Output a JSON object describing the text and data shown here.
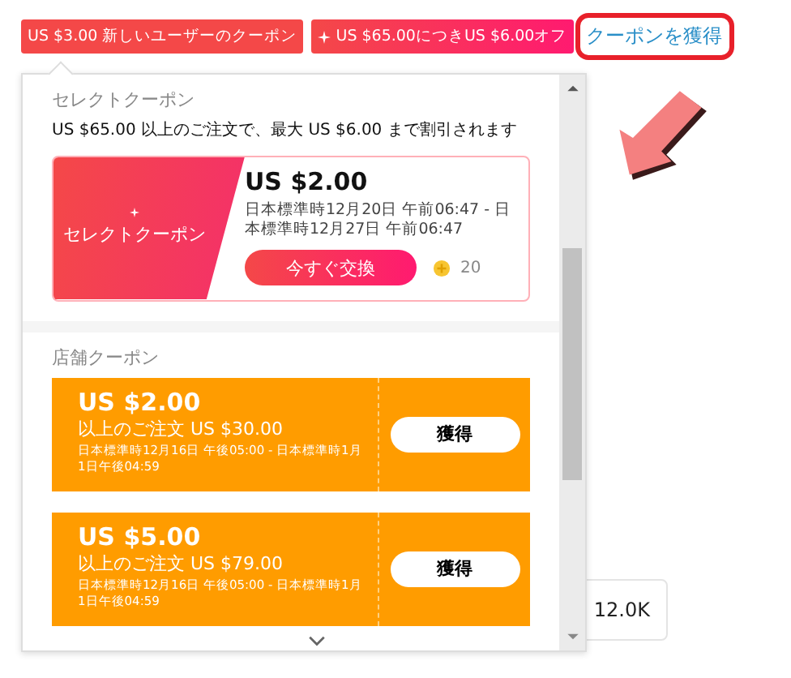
{
  "tags": [
    {
      "text": "US $3.00 新しいユーザーのクーポン",
      "kind": "plain"
    },
    {
      "text": "US $65.00につきUS $6.00オフ",
      "kind": "spark"
    }
  ],
  "get_coupon_link": {
    "text": "クーポンを獲得",
    "highlighted": true
  },
  "popup": {
    "select_section": {
      "title": "セレクトクーポン",
      "description": "US $65.00 以上のご注文で、最大 US $6.00 まで割引されます",
      "card": {
        "label": "セレクトクーポン",
        "amount": "US $2.00",
        "validity": "日本標準時12月20日 午前06:47 - 日本標準時12月27日 午前06:47",
        "button": "今すぐ交換",
        "coins": "20"
      }
    },
    "store_section": {
      "title": "店舗クーポン",
      "coupons": [
        {
          "amount": "US $2.00",
          "condition": "以上のご注文 US $30.00",
          "validity": "日本標準時12月16日 午後05:00 - 日本標準時1月1日午後04:59",
          "button": "獲得"
        },
        {
          "amount": "US $5.00",
          "condition": "以上のご注文 US $79.00",
          "validity": "日本標準時12月16日 午後05:00 - 日本標準時1月1日午後04:59",
          "button": "獲得"
        }
      ]
    }
  },
  "stat_box": {
    "value": "12.0K"
  }
}
